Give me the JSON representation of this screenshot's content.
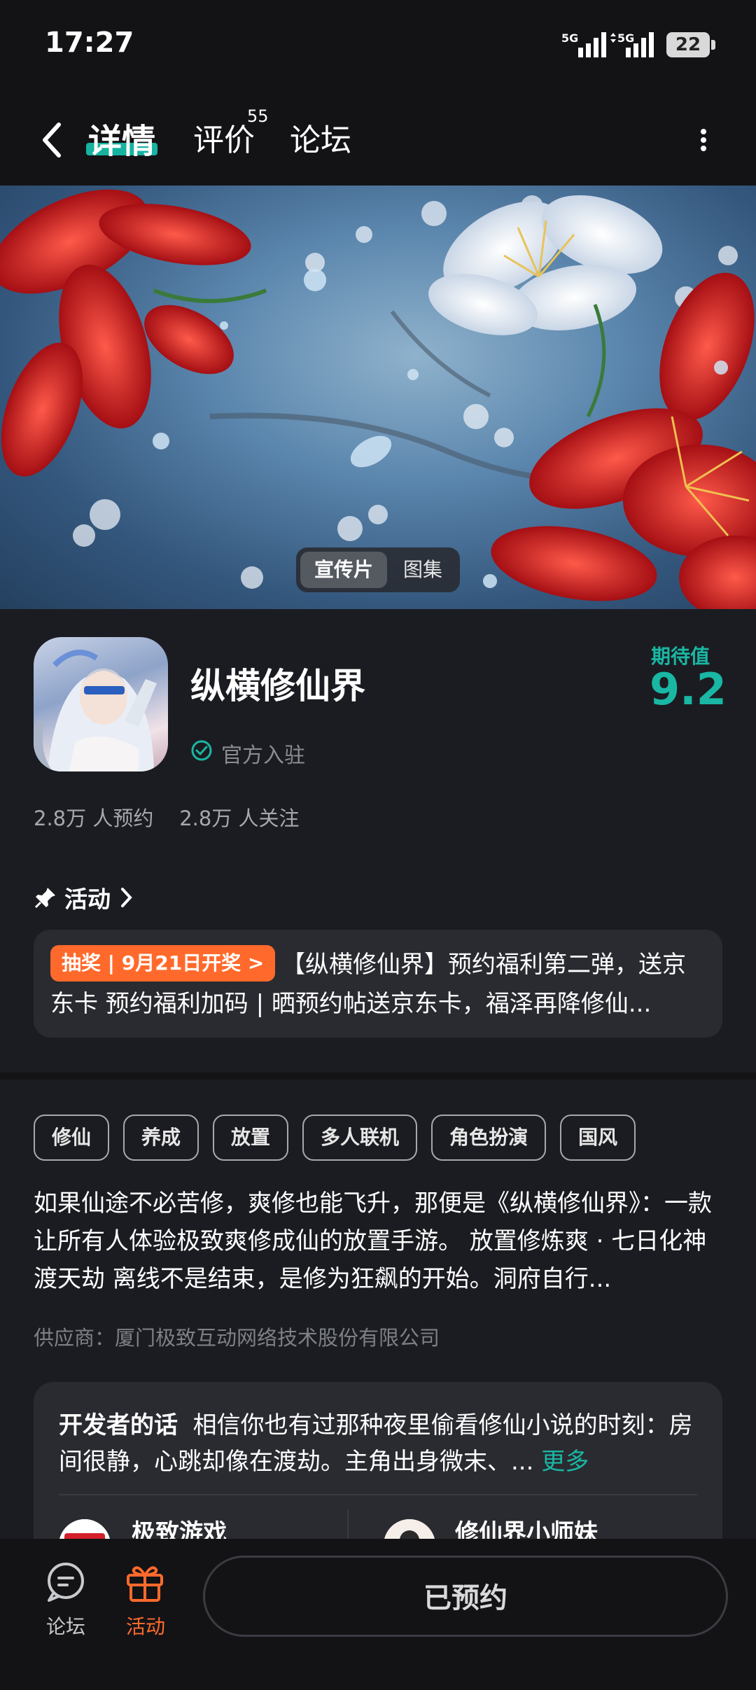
{
  "status": {
    "time": "17:27",
    "battery": "22",
    "signal1": "5G",
    "signal2": "5G"
  },
  "nav": {
    "tabs": [
      {
        "label": "详情",
        "active": true
      },
      {
        "label": "评价",
        "badge": "55"
      },
      {
        "label": "论坛"
      }
    ]
  },
  "hero": {
    "toggle_active": "宣传片",
    "toggle_inactive": "图集"
  },
  "app": {
    "name": "纵横修仙界",
    "verified": "官方入驻",
    "expect_label": "期待值",
    "expect_value": "9.2",
    "stats": "2.8万 人预约    2.8万 人关注"
  },
  "activity": {
    "title": "活动",
    "badge": "抽奖 | 9月21日开奖 >",
    "text": "【纵横修仙界】预约福利第二弹，送京东卡 预约福利加码 | 晒预约帖送京东卡，福泽再降修仙..."
  },
  "tags": [
    "修仙",
    "养成",
    "放置",
    "多人联机",
    "角色扮演",
    "国风"
  ],
  "description": "如果仙途不必苦修，爽修也能飞升，那便是《纵横修仙界》：一款让所有人体验极致爽修成仙的放置手游。 放置修炼爽 · 七日化神渡天劫 离线不是结束，是修为狂飙的开始。洞府自行...",
  "supplier": "供应商：厦门极致互动网络技术股份有限公司",
  "developer": {
    "title": "开发者的话",
    "text": "相信你也有过那种夜里偷看修仙小说的时刻：房间很静，心跳却像在渡劫。主角出身微末、...",
    "more": "更多",
    "authors": [
      "极致游戏",
      "修仙界小师妹"
    ]
  },
  "bottom": {
    "forum": "论坛",
    "activity": "活动",
    "reserved": "已预约"
  },
  "colors": {
    "accent": "#19b7a4",
    "orange": "#ff6a2c",
    "bg": "#1b1c21"
  }
}
